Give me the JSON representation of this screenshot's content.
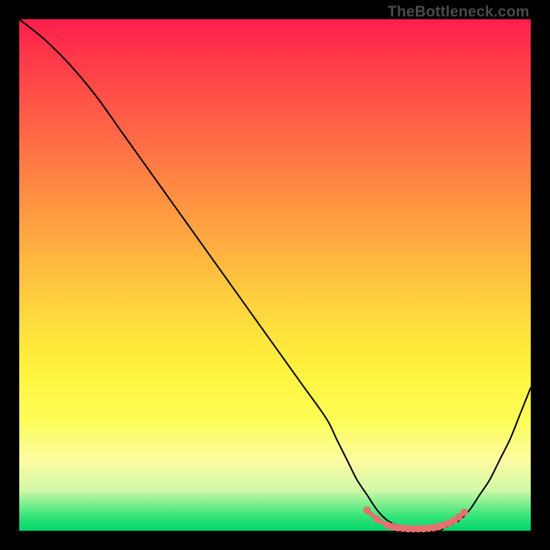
{
  "watermark": "TheBottleneck.com",
  "colors": {
    "curve_stroke": "#000000",
    "marker_fill": "#e4716f",
    "marker_stroke": "#e4716f"
  },
  "chart_data": {
    "type": "line",
    "title": "",
    "xlabel": "",
    "ylabel": "",
    "xlim": [
      0,
      100
    ],
    "ylim": [
      0,
      100
    ],
    "grid": false,
    "legend": false,
    "series": [
      {
        "name": "bottleneck-curve",
        "x": [
          0,
          5,
          10,
          15,
          20,
          25,
          30,
          35,
          40,
          45,
          50,
          55,
          60,
          62,
          64,
          66,
          68,
          70,
          72,
          74,
          76,
          78,
          80,
          82,
          84,
          86,
          88,
          90,
          92,
          94,
          96,
          98,
          100
        ],
        "y": [
          100,
          96,
          91,
          85,
          78,
          71,
          64,
          57,
          50,
          43,
          36,
          29,
          22,
          18,
          14,
          10,
          7,
          4,
          2,
          1,
          0,
          0,
          0,
          0,
          1,
          2,
          4,
          7,
          10,
          14,
          18,
          23,
          28
        ]
      }
    ],
    "markers": {
      "name": "optimal-range",
      "x": [
        68,
        70,
        72,
        73,
        74,
        75,
        76,
        77,
        78,
        79,
        80,
        81,
        82,
        83,
        84,
        85,
        86,
        87
      ],
      "y": [
        4,
        2.2,
        1.1,
        0.8,
        0.6,
        0.5,
        0.4,
        0.4,
        0.4,
        0.4,
        0.5,
        0.6,
        0.8,
        1.1,
        1.5,
        2.0,
        2.7,
        3.6
      ]
    }
  }
}
